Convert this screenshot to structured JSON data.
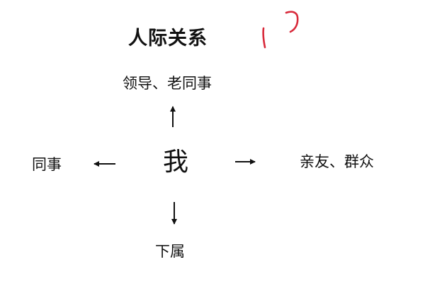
{
  "diagram": {
    "title": "人际关系",
    "center": "我",
    "up": "领导、老同事",
    "left": "同事",
    "right": "亲友、群众",
    "down": "下属"
  },
  "colors": {
    "ink": "#111111",
    "annotation": "#d8293a",
    "background": "#ffffff"
  }
}
